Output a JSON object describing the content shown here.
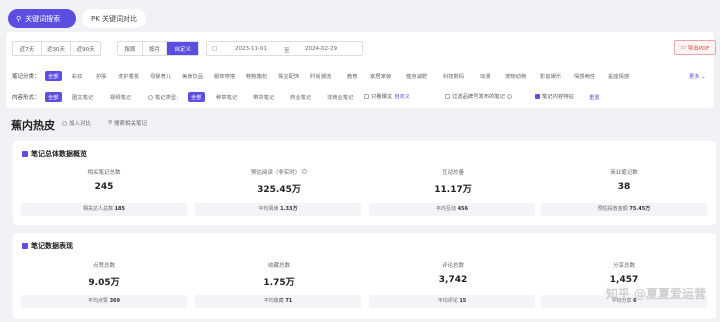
{
  "tabs": {
    "active": "关键词搜索",
    "inactive": "PK 关键词对比"
  },
  "periods": [
    "近7天",
    "近30天",
    "近90天"
  ],
  "granularity": [
    "按周",
    "按月",
    "自定义"
  ],
  "granularity_active": "自定义",
  "date_range": {
    "start": "2023-11-01",
    "sep": "至",
    "end": "2024-02-29"
  },
  "export_label": "导出PDF",
  "category": {
    "label": "笔记分类：",
    "items": [
      "全部",
      "彩妆",
      "护肤",
      "洗护香氛",
      "母婴育儿",
      "美食饮品",
      "服饰穿搭",
      "鞋靴箱包",
      "珠宝配饰",
      "时尚潮流",
      "教育",
      "家居家装",
      "健身减肥",
      "科技数码",
      "动漫",
      "宠物动物",
      "影音娱乐",
      "情感两性",
      "星座情感"
    ],
    "more": "更多"
  },
  "content": {
    "label": "内容形式：",
    "forms": [
      "全部",
      "图文笔记",
      "视频笔记"
    ],
    "type_label": "笔记类型：",
    "types": [
      "全部",
      "种草笔记",
      "带货笔记",
      "商业笔记",
      "非商业笔记"
    ],
    "only_ads": "只看爆文",
    "ads_link": "自定义",
    "filter_brand": "过滤品牌号发布的笔记",
    "keyword_note": "笔记内容特征",
    "reset": "重置"
  },
  "keyword": {
    "title": "蕉内热皮",
    "add_compare": "加入对比",
    "search_related": "搜索相关笔记"
  },
  "overview": {
    "title": "笔记总体数据概览",
    "metrics": [
      {
        "label": "相关笔记总数",
        "value": "245",
        "sub_label": "相关达人总数",
        "sub_value": "185"
      },
      {
        "label": "预估阅读（非实时）",
        "value": "325.45万",
        "sub_label": "平均阅读",
        "sub_value": "1.33万"
      },
      {
        "label": "互动总量",
        "value": "11.17万",
        "sub_label": "平均互动",
        "sub_value": "456"
      },
      {
        "label": "商业笔记数",
        "value": "38",
        "sub_label": "预估投放金额",
        "sub_value": "75.45万"
      }
    ]
  },
  "performance": {
    "title": "笔记数据表现",
    "metrics": [
      {
        "label": "点赞总数",
        "value": "9.05万",
        "sub_label": "平均点赞",
        "sub_value": "369"
      },
      {
        "label": "收藏总数",
        "value": "1.75万",
        "sub_label": "平均收藏",
        "sub_value": "71"
      },
      {
        "label": "评论总数",
        "value": "3,742",
        "sub_label": "平均评论",
        "sub_value": "15"
      },
      {
        "label": "分享总数",
        "value": "1,457",
        "sub_label": "平均分享",
        "sub_value": "6"
      }
    ]
  },
  "watermark": "知乎 @夏夏爱运营"
}
